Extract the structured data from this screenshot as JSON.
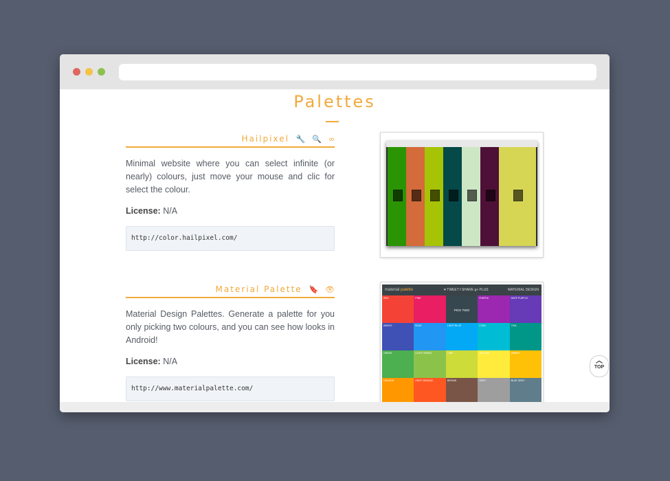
{
  "page": {
    "title": "Palettes",
    "accent": "#f2a93b",
    "background": "#565d6e"
  },
  "window": {
    "controls": [
      "close",
      "minimize",
      "maximize"
    ],
    "url": ""
  },
  "entries": [
    {
      "name": "Hailpixel",
      "icons": [
        "wrench-icon",
        "magnifier-icon",
        "infinity-icon"
      ],
      "icon_glyphs": [
        "🔧",
        "🔍",
        "∞"
      ],
      "description": "Minimal website where you can select infinite (or nearly) colours, just move your mouse and clic for select the colour.",
      "license_label": "License:",
      "license_value": "N/A",
      "url": "http://color.hailpixel.com/"
    },
    {
      "name": "Material Palette",
      "icons": [
        "bookmark-icon",
        "eye-icon"
      ],
      "icon_glyphs": [
        "🔖",
        "👁"
      ],
      "description": "Material Design Palettes. Generate a palette for you only picking two colours, and you can see how looks in Android!",
      "license_label": "License:",
      "license_value": "N/A",
      "url": "http://www.materialpalette.com/"
    }
  ],
  "hailpixel_preview": {
    "columns": [
      "#2a9404",
      "#d46b3a",
      "#a6c405",
      "#064949",
      "#cde7c5",
      "#4f1038",
      "#d6d654"
    ]
  },
  "material_preview": {
    "brand_prefix": "material",
    "brand_suffix": "palette",
    "actions": "♥ TWEET   f SHARE   g+ PLUS",
    "md_label": "MATERIAL DESIGN",
    "pick_label": "PICK TWO COLORS",
    "cells": [
      {
        "label": "RED",
        "color": "#f44336"
      },
      {
        "label": "PINK",
        "color": "#e91e63"
      },
      {
        "label": "",
        "color": "#37474f",
        "pick": true
      },
      {
        "label": "PURPLE",
        "color": "#9c27b0"
      },
      {
        "label": "DEEP PURPLE",
        "color": "#673ab7"
      },
      {
        "label": "INDIGO",
        "color": "#3f51b5"
      },
      {
        "label": "BLUE",
        "color": "#2196f3"
      },
      {
        "label": "LIGHT BLUE",
        "color": "#03a9f4"
      },
      {
        "label": "CYAN",
        "color": "#00bcd4"
      },
      {
        "label": "TEAL",
        "color": "#009688"
      },
      {
        "label": "GREEN",
        "color": "#4caf50"
      },
      {
        "label": "LIGHT GREEN",
        "color": "#8bc34a"
      },
      {
        "label": "LIME",
        "color": "#cddc39"
      },
      {
        "label": "YELLOW",
        "color": "#ffeb3b"
      },
      {
        "label": "AMBER",
        "color": "#ffc107"
      },
      {
        "label": "ORANGE",
        "color": "#ff9800"
      },
      {
        "label": "DEEP ORANGE",
        "color": "#ff5722"
      },
      {
        "label": "BROWN",
        "color": "#795548"
      },
      {
        "label": "GREY",
        "color": "#9e9e9e"
      },
      {
        "label": "BLUE GREY",
        "color": "#607d8b"
      }
    ]
  },
  "top_button": {
    "label": "TOP",
    "icon": "chevron-up-icon"
  }
}
